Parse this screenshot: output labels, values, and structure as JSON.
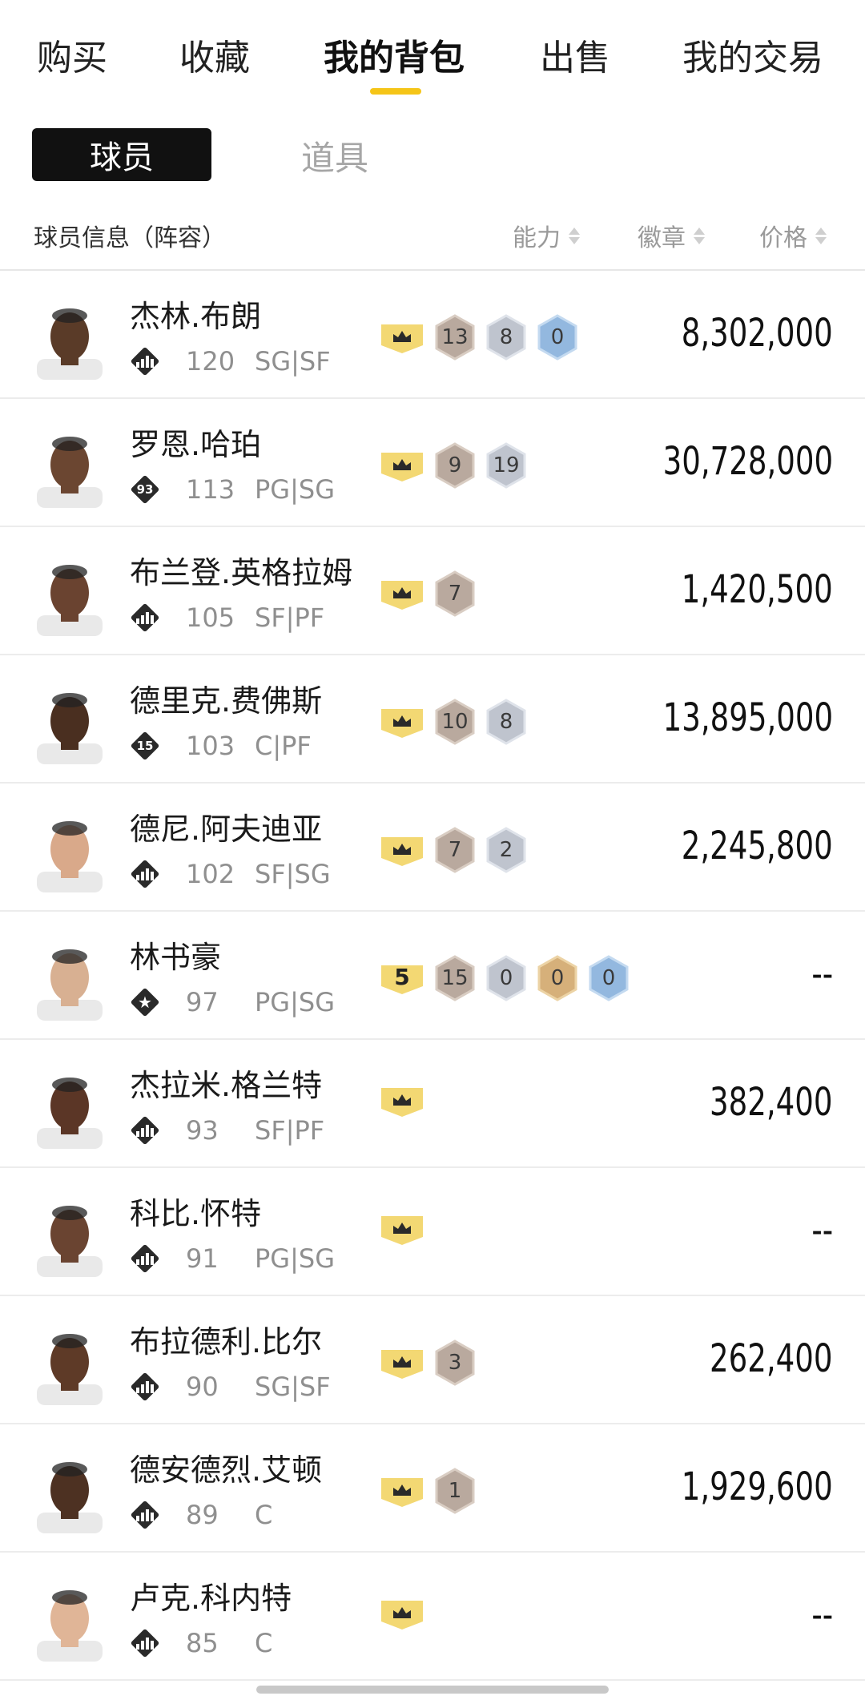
{
  "top_tabs": [
    "购买",
    "收藏",
    "我的背包",
    "出售",
    "我的交易"
  ],
  "active_top_tab": "我的背包",
  "sub_tabs": [
    "球员",
    "道具"
  ],
  "header": {
    "info": "球员信息（阵容）",
    "ability": "能力",
    "badges": "徽章",
    "price": "价格"
  },
  "colors": {
    "accent": "#f5c518",
    "crown": "#f3d873",
    "bronze": "#b8a89c",
    "silver": "#b9bfcb",
    "gold": "#d9b47e",
    "blue": "#8fb5de"
  },
  "players": [
    {
      "name": "杰林.布朗",
      "badge_icon": "bars-icon",
      "badge_text": "",
      "ovr": "120",
      "pos": "SG|SF",
      "crown": "crown",
      "badges": [
        {
          "t": "bronze",
          "n": "13"
        },
        {
          "t": "silver",
          "n": "8"
        },
        {
          "t": "blue",
          "n": "0"
        }
      ],
      "price": "8,302,000",
      "skin": "#5a3b28"
    },
    {
      "name": "罗恩.哈珀",
      "badge_icon": "number-badge-icon",
      "badge_text": "93",
      "ovr": "113",
      "pos": "PG|SG",
      "crown": "crown",
      "badges": [
        {
          "t": "bronze",
          "n": "9"
        },
        {
          "t": "silver",
          "n": "19"
        }
      ],
      "price": "30,728,000",
      "skin": "#6b4631"
    },
    {
      "name": "布兰登.英格拉姆",
      "badge_icon": "bars-icon",
      "badge_text": "",
      "ovr": "105",
      "pos": "SF|PF",
      "crown": "crown",
      "badges": [
        {
          "t": "bronze",
          "n": "7"
        }
      ],
      "price": "1,420,500",
      "skin": "#6a4330"
    },
    {
      "name": "德里克.费佛斯",
      "badge_icon": "number-badge-icon",
      "badge_text": "15",
      "ovr": "103",
      "pos": "C|PF",
      "crown": "crown",
      "badges": [
        {
          "t": "bronze",
          "n": "10"
        },
        {
          "t": "silver",
          "n": "8"
        }
      ],
      "price": "13,895,000",
      "skin": "#4a2f20"
    },
    {
      "name": "德尼.阿夫迪亚",
      "badge_icon": "bars-icon",
      "badge_text": "",
      "ovr": "102",
      "pos": "SF|SG",
      "crown": "crown",
      "badges": [
        {
          "t": "bronze",
          "n": "7"
        },
        {
          "t": "silver",
          "n": "2"
        }
      ],
      "price": "2,245,800",
      "skin": "#d9a98a"
    },
    {
      "name": "林书豪",
      "badge_icon": "star-badge-icon",
      "badge_text": "",
      "ovr": "97",
      "pos": "PG|SG",
      "crown": "5",
      "badges": [
        {
          "t": "bronze",
          "n": "15"
        },
        {
          "t": "silver",
          "n": "0"
        },
        {
          "t": "gold",
          "n": "0"
        },
        {
          "t": "blue",
          "n": "0"
        }
      ],
      "price": "--",
      "skin": "#d8b092"
    },
    {
      "name": "杰拉米.格兰特",
      "badge_icon": "bars-icon",
      "badge_text": "",
      "ovr": "93",
      "pos": "SF|PF",
      "crown": "crown",
      "badges": [],
      "price": "382,400",
      "skin": "#5b3626"
    },
    {
      "name": "科比.怀特",
      "badge_icon": "bars-icon",
      "badge_text": "",
      "ovr": "91",
      "pos": "PG|SG",
      "crown": "crown",
      "badges": [],
      "price": "--",
      "skin": "#6a4431"
    },
    {
      "name": "布拉德利.比尔",
      "badge_icon": "bars-icon",
      "badge_text": "",
      "ovr": "90",
      "pos": "SG|SF",
      "crown": "crown",
      "badges": [
        {
          "t": "bronze",
          "n": "3"
        }
      ],
      "price": "262,400",
      "skin": "#5e3a27"
    },
    {
      "name": "德安德烈.艾顿",
      "badge_icon": "bars-icon",
      "badge_text": "",
      "ovr": "89",
      "pos": "C",
      "crown": "crown",
      "badges": [
        {
          "t": "bronze",
          "n": "1"
        }
      ],
      "price": "1,929,600",
      "skin": "#4d3122"
    },
    {
      "name": "卢克.科内特",
      "badge_icon": "bars-icon",
      "badge_text": "",
      "ovr": "85",
      "pos": "C",
      "crown": "crown",
      "badges": [],
      "price": "--",
      "skin": "#e0b597"
    }
  ]
}
